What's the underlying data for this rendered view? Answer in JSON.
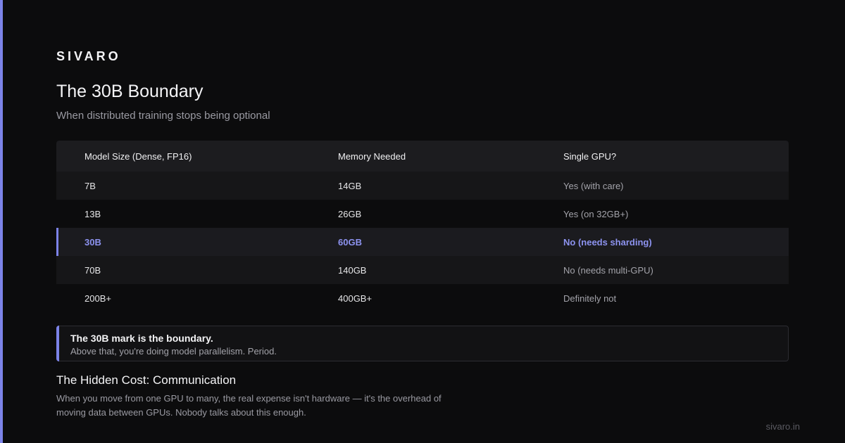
{
  "brand": "SIVARO",
  "title": "The 30B Boundary",
  "subtitle": "When distributed training stops being optional",
  "table": {
    "headers": [
      "Model Size (Dense, FP16)",
      "Memory Needed",
      "Single GPU?"
    ],
    "rows": [
      [
        "7B",
        "14GB",
        "Yes (with care)"
      ],
      [
        "13B",
        "26GB",
        "Yes (on 32GB+)"
      ],
      [
        "30B",
        "60GB",
        "No (needs sharding)"
      ],
      [
        "70B",
        "140GB",
        "No (needs multi-GPU)"
      ],
      [
        "200B+",
        "400GB+",
        "Definitely not"
      ]
    ]
  },
  "callout": {
    "title": "The 30B mark is the boundary.",
    "text": "Above that, you're doing model parallelism. Period."
  },
  "section": {
    "heading": "The Hidden Cost: Communication",
    "body": "When you move from one GPU to many, the real expense isn't hardware — it's the overhead of moving data between GPUs. Nobody talks about this enough."
  },
  "footer": "sivaro.in",
  "colors": {
    "accent": "#7c83e8",
    "background": "#0c0c0d"
  }
}
